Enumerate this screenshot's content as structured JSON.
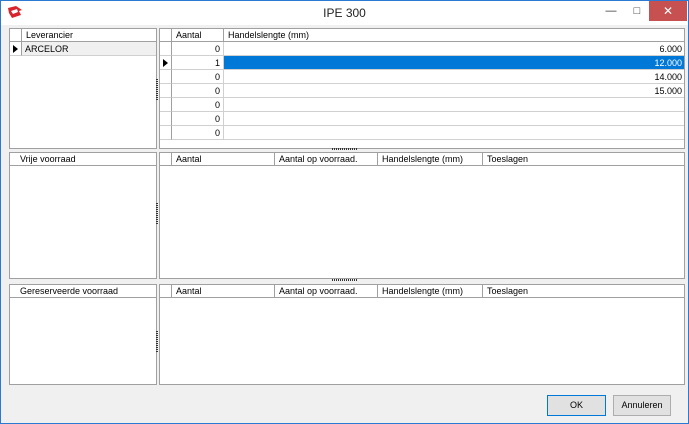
{
  "window": {
    "title": "IPE 300"
  },
  "supplier": {
    "header": "Leverancier",
    "rows": [
      {
        "name": "ARCELOR",
        "current": true
      }
    ]
  },
  "lengths": {
    "headers": {
      "qty": "Aantal",
      "length": "Handelslengte (mm)"
    },
    "rows": [
      {
        "qty": "0",
        "length": "6.000",
        "current": false,
        "selected": false
      },
      {
        "qty": "1",
        "length": "12.000",
        "current": true,
        "selected": true
      },
      {
        "qty": "0",
        "length": "14.000",
        "current": false,
        "selected": false
      },
      {
        "qty": "0",
        "length": "15.000",
        "current": false,
        "selected": false
      },
      {
        "qty": "0",
        "length": "",
        "current": false,
        "selected": false
      },
      {
        "qty": "0",
        "length": "",
        "current": false,
        "selected": false
      },
      {
        "qty": "0",
        "length": "",
        "current": false,
        "selected": false
      }
    ]
  },
  "free_stock": {
    "left_header": "Vrije voorraad",
    "headers": {
      "qty": "Aantal",
      "qty_stock": "Aantal op voorraad.",
      "length": "Handelslengte (mm)",
      "surcharges": "Toeslagen"
    }
  },
  "reserved_stock": {
    "left_header": "Gereserveerde voorraad",
    "headers": {
      "qty": "Aantal",
      "qty_stock": "Aantal op voorraad.",
      "length": "Handelslengte (mm)",
      "surcharges": "Toeslagen"
    }
  },
  "buttons": {
    "ok": "OK",
    "cancel": "Annuleren"
  },
  "colors": {
    "selection": "#0078d7",
    "close": "#c75050",
    "border": "#2b79d0"
  }
}
